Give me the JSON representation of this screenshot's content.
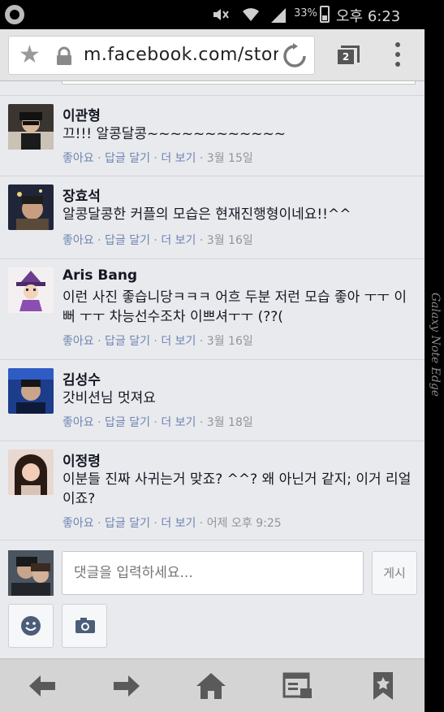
{
  "status_bar": {
    "battery": "33%",
    "time": "오후 6:23"
  },
  "browser": {
    "url": "m.facebook.com/story",
    "tab_count": "2"
  },
  "comments": [
    {
      "author": "이관형",
      "text": "끄!!! 알콩달콩~~~~~~~~~~~~",
      "like": "좋아요",
      "reply": "답글 달기",
      "more": "더 보기",
      "time": "3월 15일"
    },
    {
      "author": "장효석",
      "text": "알콩달콩한 커플의 모습은 현재진행형이네요!!^^",
      "like": "좋아요",
      "reply": "답글 달기",
      "more": "더 보기",
      "time": "3월 16일"
    },
    {
      "author": "Aris Bang",
      "text": "이런 사진 좋습니당ㅋㅋㅋ 어흐 두분 저런 모습 좋아 ㅜㅜ 이뻐 ㅜㅜ 차능선수조차 이쁘셔ㅜㅜ (??(",
      "like": "좋아요",
      "reply": "답글 달기",
      "more": "더 보기",
      "time": "3월 16일"
    },
    {
      "author": "김성수",
      "text": "갓비션님 멋져요",
      "like": "좋아요",
      "reply": "답글 달기",
      "more": "더 보기",
      "time": "3월 18일"
    },
    {
      "author": "이정령",
      "text": "이분들 진짜 사귀는거 맞죠? ^^? 왜 아닌거 같지; 이거 리얼이죠?",
      "like": "좋아요",
      "reply": "답글 달기",
      "more": "더 보기",
      "time": "어제 오후 9:25"
    }
  ],
  "composer": {
    "placeholder": "댓글을 입력하세요...",
    "post_label": "게시"
  },
  "device": {
    "edge_label": "Galaxy Note Edge"
  },
  "colors": {
    "link": "#6d84b4",
    "meta": "#90949c",
    "background": "#e9eaed"
  }
}
